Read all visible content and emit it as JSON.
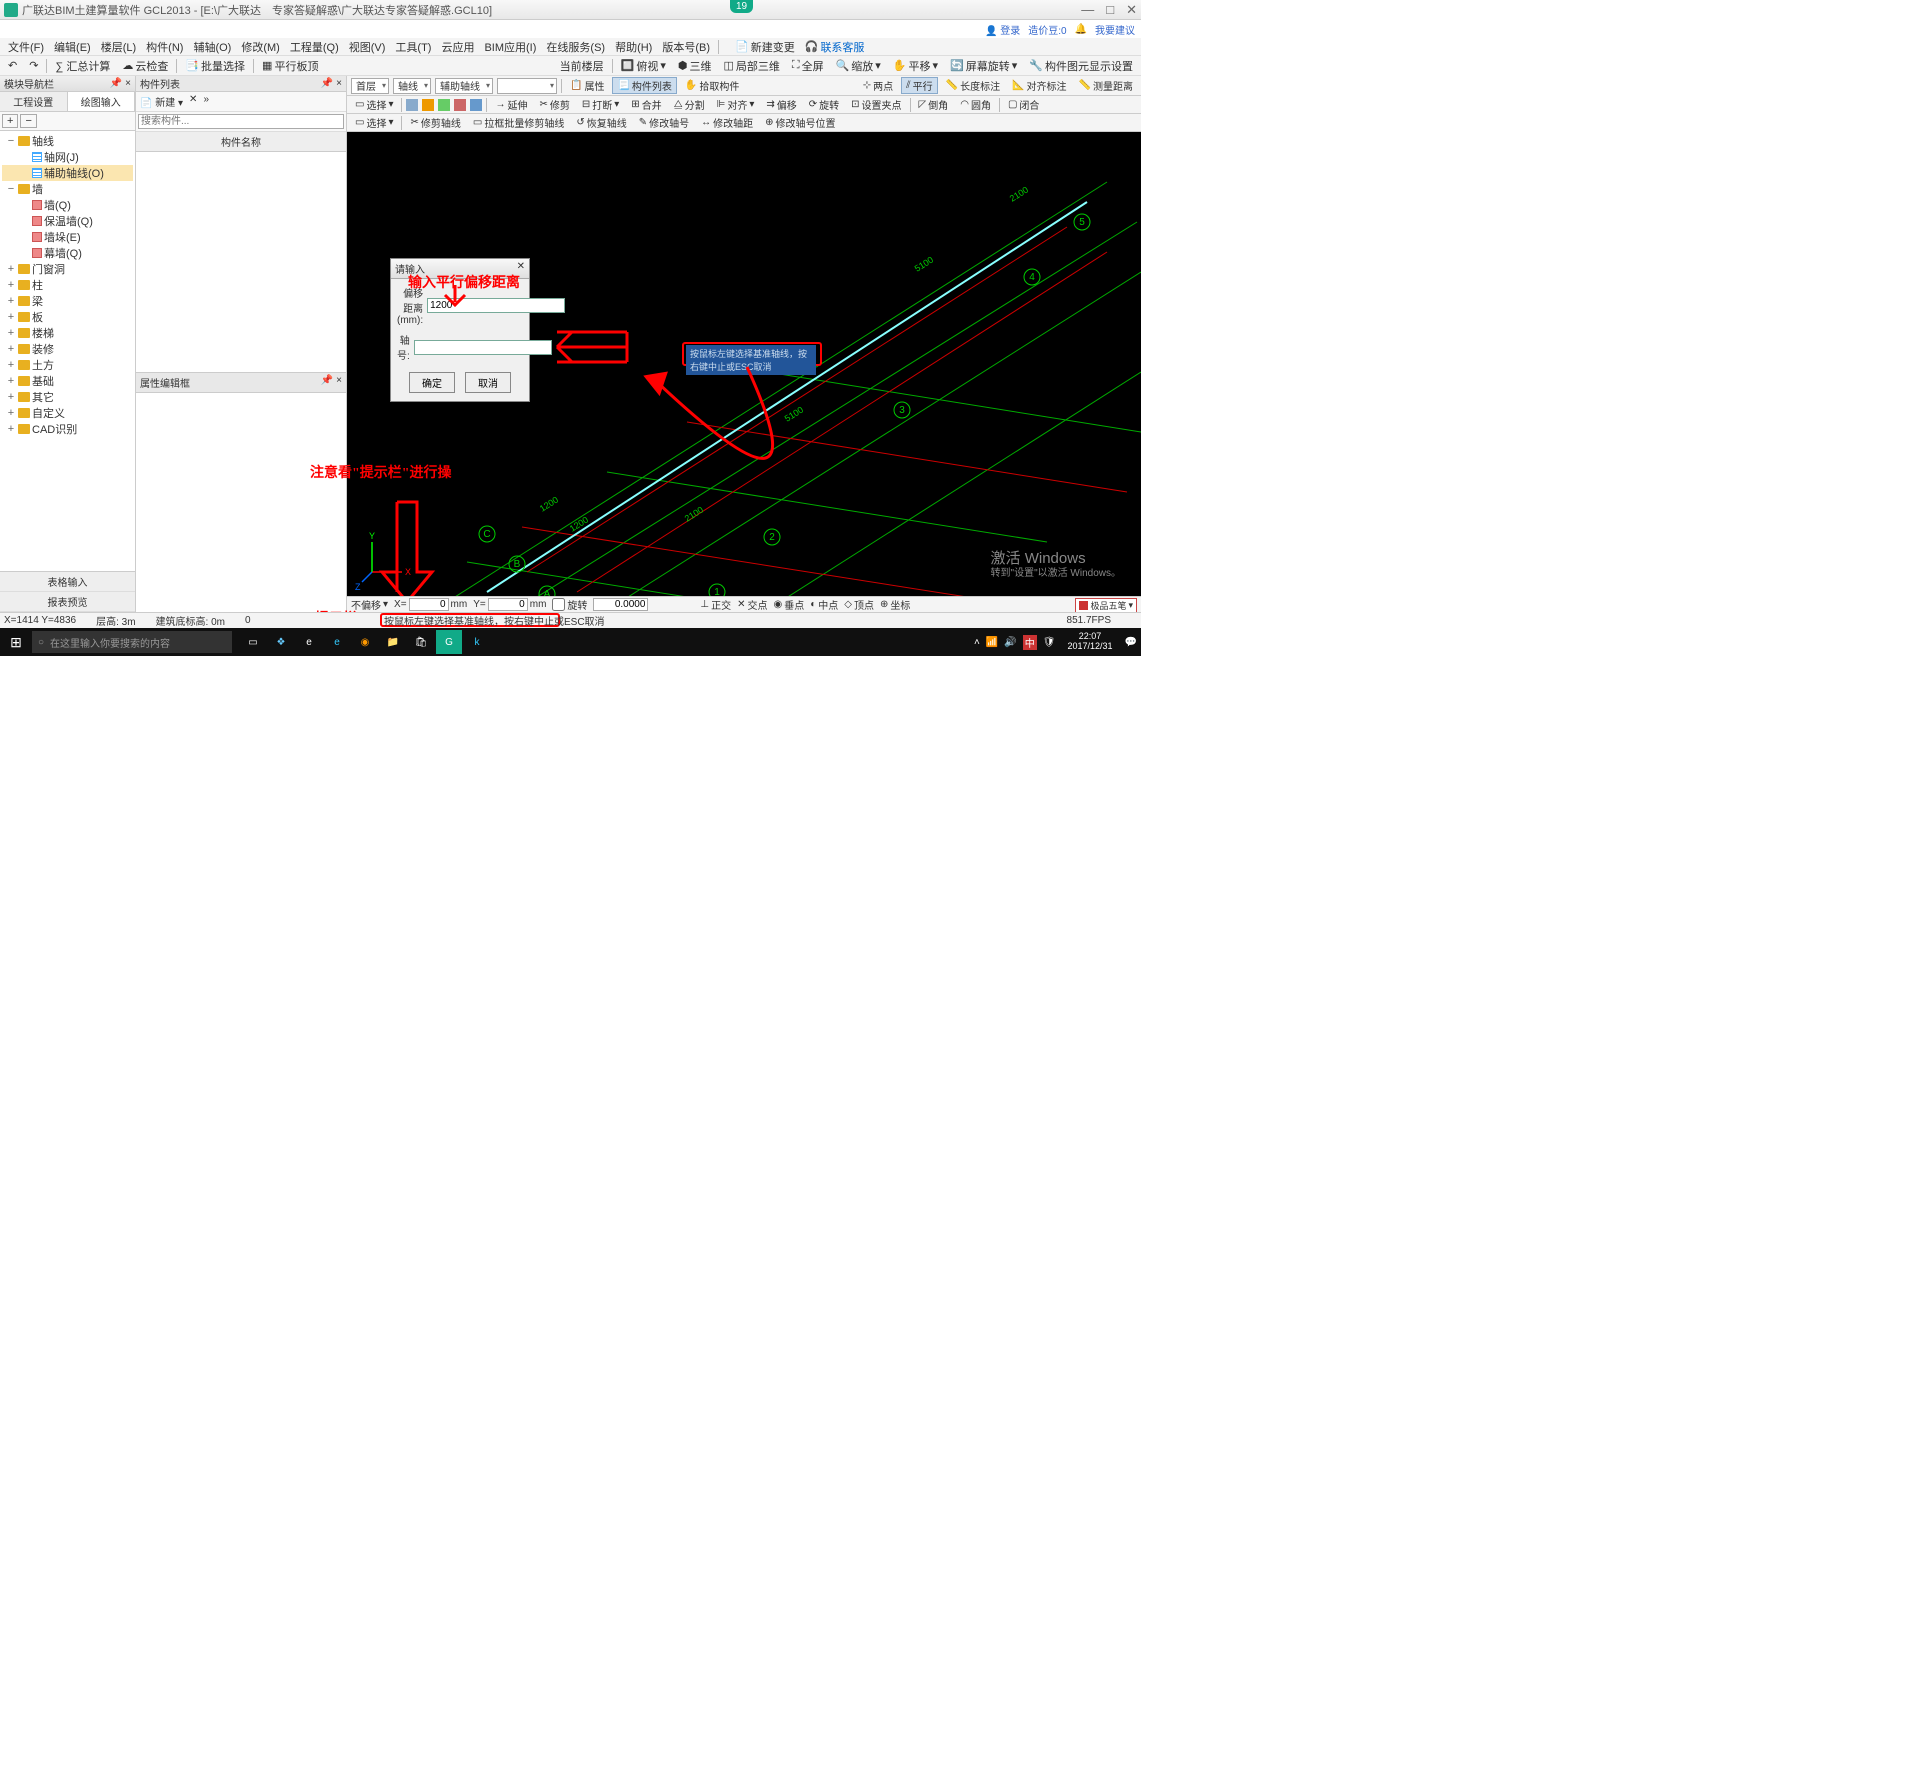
{
  "titlebar": {
    "title": "广联达BIM土建算量软件 GCL2013 - [E:\\广大联达　专家答疑解惑\\广大联达专家答疑解惑.GCL10]",
    "badge": "19"
  },
  "top_right": {
    "login": "登录",
    "price": "造价豆:0",
    "bell": "🔔",
    "feedback": "我要建议"
  },
  "menus": [
    "文件(F)",
    "编辑(E)",
    "楼层(L)",
    "构件(N)",
    "辅轴(O)",
    "修改(M)",
    "工程量(Q)",
    "视图(V)",
    "工具(T)",
    "云应用",
    "BIM应用(I)",
    "在线服务(S)",
    "帮助(H)",
    "版本号(B)"
  ],
  "menu_extra": {
    "new_change": "新建变更",
    "contact": "联系客服"
  },
  "tb2": {
    "calc": "∑ 汇总计算",
    "cloud": "云检查",
    "batch": "批量选择",
    "parallel": "平行板顶",
    "current": "当前楼层",
    "copy": "俯视",
    "three": "三维",
    "partial": "局部三维",
    "full": "全屏",
    "zoom": "缩放",
    "pan": "平移",
    "rotate": "屏幕旋转",
    "display": "构件图元显示设置"
  },
  "left": {
    "panel_title": "模块导航栏",
    "tabs": {
      "project": "工程设置",
      "draw": "绘图输入"
    },
    "tree": [
      {
        "tw": "−",
        "icon": "folder",
        "label": "轴线",
        "depth": 0
      },
      {
        "tw": "",
        "icon": "grid",
        "label": "轴网(J)",
        "depth": 1,
        "sel": false
      },
      {
        "tw": "",
        "icon": "grid",
        "label": "辅助轴线(O)",
        "depth": 1,
        "sel": true
      },
      {
        "tw": "−",
        "icon": "folder",
        "label": "墙",
        "depth": 0
      },
      {
        "tw": "",
        "icon": "wall",
        "label": "墙(Q)",
        "depth": 1
      },
      {
        "tw": "",
        "icon": "wall",
        "label": "保温墙(Q)",
        "depth": 1
      },
      {
        "tw": "",
        "icon": "wall",
        "label": "墙垛(E)",
        "depth": 1
      },
      {
        "tw": "",
        "icon": "wall",
        "label": "幕墙(Q)",
        "depth": 1
      },
      {
        "tw": "+",
        "icon": "folder",
        "label": "门窗洞",
        "depth": 0
      },
      {
        "tw": "+",
        "icon": "folder",
        "label": "柱",
        "depth": 0
      },
      {
        "tw": "+",
        "icon": "folder",
        "label": "梁",
        "depth": 0
      },
      {
        "tw": "+",
        "icon": "folder",
        "label": "板",
        "depth": 0
      },
      {
        "tw": "+",
        "icon": "folder",
        "label": "楼梯",
        "depth": 0
      },
      {
        "tw": "+",
        "icon": "folder",
        "label": "装修",
        "depth": 0
      },
      {
        "tw": "+",
        "icon": "folder",
        "label": "土方",
        "depth": 0
      },
      {
        "tw": "+",
        "icon": "folder",
        "label": "基础",
        "depth": 0
      },
      {
        "tw": "+",
        "icon": "folder",
        "label": "其它",
        "depth": 0
      },
      {
        "tw": "+",
        "icon": "folder",
        "label": "自定义",
        "depth": 0
      },
      {
        "tw": "+",
        "icon": "folder",
        "label": "CAD识别",
        "depth": 0
      }
    ],
    "bottom": {
      "table": "表格输入",
      "preview": "报表预览"
    }
  },
  "mid": {
    "panel_title": "构件列表",
    "new": "新建",
    "search_ph": "搜索构件...",
    "col_head": "构件名称",
    "panel2_title": "属性编辑框"
  },
  "right_tb1": {
    "floor": "首层",
    "axis": "轴线",
    "aux": "辅助轴线",
    "prop": "属性",
    "list": "构件列表",
    "pick": "拾取构件",
    "two": "两点",
    "para": "平行",
    "len": "长度标注",
    "align": "对齐标注",
    "measure": "测量距离"
  },
  "right_tb2": {
    "select": "选择",
    "extend": "延伸",
    "trim": "修剪",
    "break": "打断",
    "merge": "合并",
    "split": "分割",
    "align": "对齐",
    "offset": "偏移",
    "rotate": "旋转",
    "setpts": "设置夹点",
    "fillet": "倒角",
    "round": "圆角",
    "close": "闭合"
  },
  "right_tb3": {
    "select": "选择",
    "trim_axis": "修剪轴线",
    "batch_trim": "拉框批量修剪轴线",
    "restore": "恢复轴线",
    "edit_no": "修改轴号",
    "edit_dist": "修改轴距",
    "edit_pos": "修改轴号位置"
  },
  "dialog": {
    "title": "请输入",
    "offset_label": "偏移距离(mm):",
    "offset_value": "1200",
    "axis_label": "轴号:",
    "axis_value": "",
    "ok": "确定",
    "cancel": "取消"
  },
  "annotations": {
    "offset_hint": "输入平行偏移距离",
    "hint_bar": "注意看\"提示栏\"进行操",
    "hint_bar_label": "提示栏",
    "tooltip": "按鼠标左键选择基准轴线，按右键中止或ESC取消",
    "hint_msg": "按鼠标左键选择基准轴线，按右键中止或ESC取消"
  },
  "canvas": {
    "labels": {
      "A": "A",
      "B": "B",
      "C": "C",
      "3": "3",
      "4": "4",
      "5": "5"
    },
    "dims": {
      "d1200a": "1200",
      "d1200b": "1200",
      "d2100a": "2100",
      "d2100b": "2100",
      "d5100a": "5100",
      "d5100b": "5100"
    },
    "numbers": {
      "n1": "1",
      "n2": "2",
      "n3": "3",
      "n4": "4",
      "n5": "5"
    }
  },
  "watermark": {
    "title": "激活 Windows",
    "sub": "转到\"设置\"以激活 Windows。"
  },
  "status1": {
    "no_offset": "不偏移",
    "x": "X=",
    "xv": "0",
    "mm1": "mm",
    "y": "Y=",
    "yv": "0",
    "mm2": "mm",
    "rotate": "旋转",
    "ortho": "正交",
    "cross": "交点",
    "center": "垂点",
    "mid": "中点",
    "vertex": "顶点",
    "coord": "坐标"
  },
  "footer": {
    "coord": "X=1414  Y=4836",
    "elev": "层高: 3m",
    "bottom": "建筑底标高: 0m",
    "zero": "0",
    "fps": "851.7FPS"
  },
  "ime": "极品五笔",
  "taskbar": {
    "search_ph": "在这里输入你要搜索的内容",
    "time": "22:07",
    "date": "2017/12/31"
  }
}
